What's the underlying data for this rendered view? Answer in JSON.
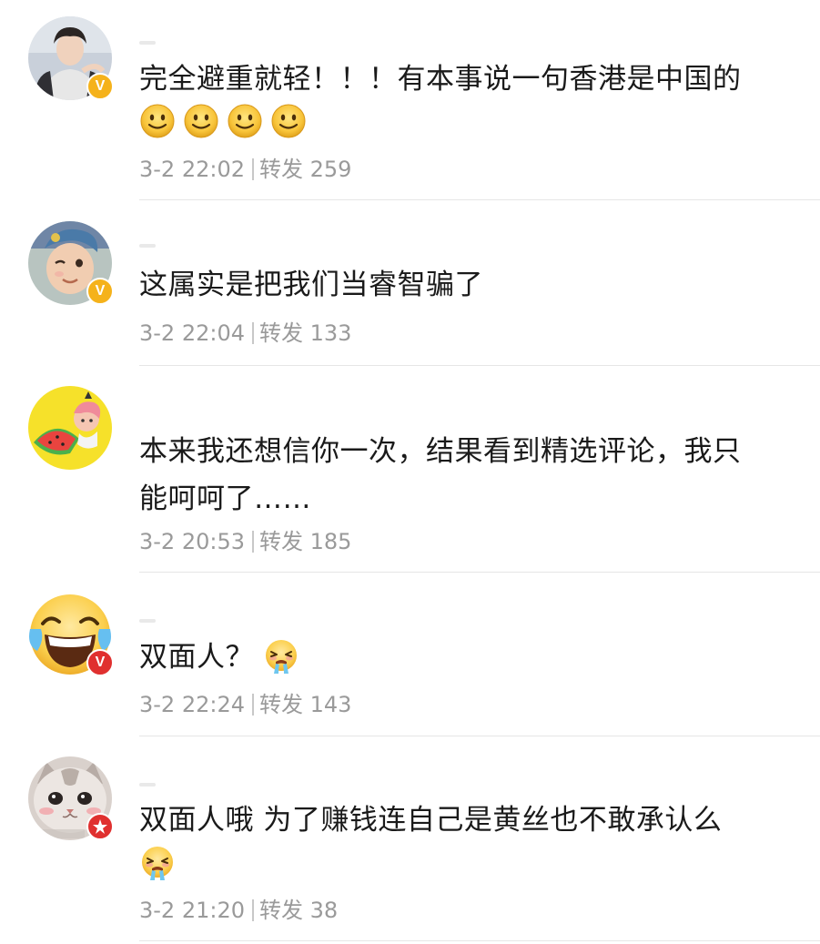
{
  "comments": [
    {
      "text": "完全避重就轻！！！有本事说一句香港是中国的",
      "emoji_count": 4,
      "emojis": [
        "smile-emoji",
        "smile-emoji",
        "smile-emoji",
        "smile-emoji"
      ],
      "time": "3-2 22:02",
      "repost_label": "转发",
      "repost_count": "259",
      "badge": "V",
      "badge_color": "#f5b21b"
    },
    {
      "text": "这属实是把我们当睿智骗了",
      "time": "3-2 22:04",
      "repost_label": "转发",
      "repost_count": "133",
      "badge": "V",
      "badge_color": "#f5b21b"
    },
    {
      "text_line1": "本来我还想信你一次，结果看到精选评论，我只",
      "text_line2": "能呵呵了……",
      "time": "3-2 20:53",
      "repost_label": "转发",
      "repost_count": "185"
    },
    {
      "text": "双面人？",
      "inline_emoji": "crying-emoji",
      "time": "3-2 22:24",
      "repost_label": "转发",
      "repost_count": "143",
      "badge": "V",
      "badge_color": "#e0302f"
    },
    {
      "text": "双面人哦 为了赚钱连自己是黄丝也不敢承认么",
      "emoji": "crying-emoji",
      "time": "3-2 21:20",
      "repost_label": "转发",
      "repost_count": "38",
      "badge_color": "#e0302f"
    }
  ],
  "colors": {
    "text": "#1a1a1a",
    "meta": "#9a9a9a",
    "divider": "#e6e6e6",
    "verified_gold": "#f5b21b",
    "verified_red": "#e0302f"
  }
}
